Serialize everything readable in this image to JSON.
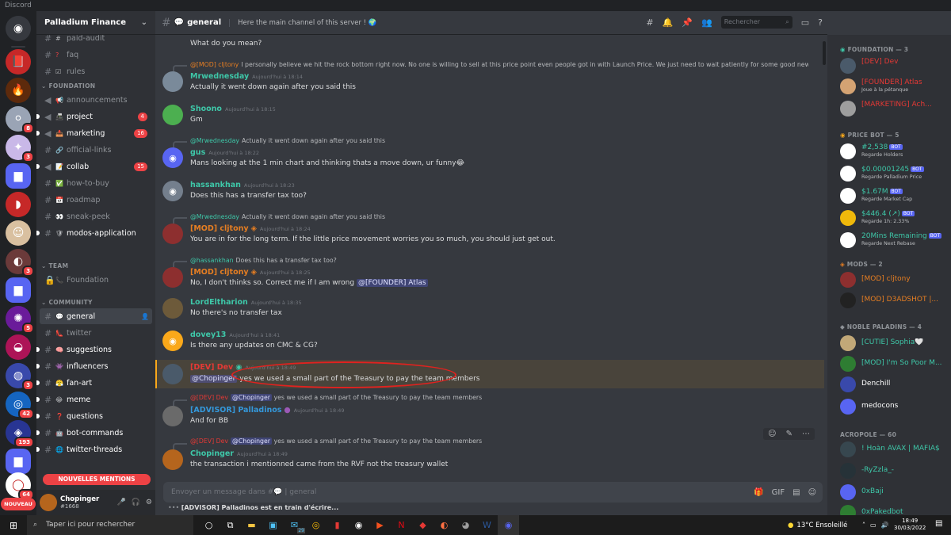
{
  "window_title": "Discord",
  "server": {
    "name": "Palladium Finance"
  },
  "rail": {
    "badges": [
      "8",
      "3",
      "3",
      "5",
      "3",
      "42",
      "193",
      "64"
    ],
    "new_label": "NOUVEAU"
  },
  "channels": {
    "top": [
      {
        "name": "paid-audit",
        "icon": "#"
      },
      {
        "name": "faq",
        "icon": "?"
      },
      {
        "name": "rules",
        "icon": "☑"
      }
    ],
    "cat_foundation": "FOUNDATION",
    "foundation": [
      {
        "name": "announcements",
        "icon": "📢",
        "badge": ""
      },
      {
        "name": "project",
        "icon": "📠",
        "badge": "4"
      },
      {
        "name": "marketing",
        "icon": "📥",
        "badge": "16"
      },
      {
        "name": "official-links",
        "icon": "🔗",
        "badge": ""
      },
      {
        "name": "collab",
        "icon": "📝",
        "badge": "15"
      },
      {
        "name": "how-to-buy",
        "icon": "✅",
        "badge": ""
      },
      {
        "name": "roadmap",
        "icon": "📅",
        "badge": ""
      },
      {
        "name": "sneak-peek",
        "icon": "👀",
        "badge": ""
      },
      {
        "name": "modos-application",
        "icon": "🛡",
        "badge": ""
      }
    ],
    "cat_team": "TEAM",
    "team": [
      {
        "name": "Foundation",
        "icon": "📞"
      }
    ],
    "cat_community": "COMMUNITY",
    "community": [
      {
        "name": "general",
        "icon": "💬"
      },
      {
        "name": "twitter",
        "icon": "👠"
      },
      {
        "name": "suggestions",
        "icon": "🧠"
      },
      {
        "name": "influencers",
        "icon": "👾"
      },
      {
        "name": "fan-art",
        "icon": "😤"
      },
      {
        "name": "meme",
        "icon": "😂"
      },
      {
        "name": "questions",
        "icon": "❓"
      },
      {
        "name": "bot-commands",
        "icon": "🤖"
      },
      {
        "name": "twitter-threads",
        "icon": "🌐"
      }
    ],
    "new_mentions": "NOUVELLES MENTIONS"
  },
  "user": {
    "name": "Chopinger",
    "tag": "#1668"
  },
  "header": {
    "channel": "general",
    "topic": "Here the main channel of this server ! 🌍",
    "search_placeholder": "Rechercher"
  },
  "messages": [
    {
      "author": "",
      "time": "",
      "text": "What do you mean?"
    },
    {
      "reply_author": "@[MOD] cljtony",
      "reply_text": "I personally believe we hit the rock bottom right now. No one is willing to sell at this price point even people got in with Launch Price. We just need to wait patiently for some good news and ...",
      "author": "Mrwednesday",
      "time": "Aujourd'hui à 18:14",
      "text": "Actually it went down again after you said this"
    },
    {
      "author": "Shoono",
      "time": "Aujourd'hui à 18:15",
      "text": "Gm"
    },
    {
      "reply_author": "@Mrwednesday",
      "reply_text": "Actually it went down again after you said this",
      "author": "gus",
      "time": "Aujourd'hui à 18:22",
      "text": "Mans looking at the 1 min chart and thinking thats a move down, ur funny😂"
    },
    {
      "author": "hassankhan",
      "time": "Aujourd'hui à 18:23",
      "text": "Does this has a transfer tax too?"
    },
    {
      "reply_author": "@Mrwednesday",
      "reply_text": "Actually it went down again after you said this",
      "author": "[MOD] cljtony",
      "time": "Aujourd'hui à 18:24",
      "text": "You are in for the long term. If the little price movement worries you so much, you should just get out."
    },
    {
      "reply_author": "@hassankhan",
      "reply_text": "Does this has a transfer tax too?",
      "author": "[MOD] cljtony",
      "time": "Aujourd'hui à 18:25",
      "text": "No, I don't thinks so. Correct me if I am wrong",
      "mention": "@[FOUNDER] Atlas"
    },
    {
      "author": "LordEltharion",
      "time": "Aujourd'hui à 18:35",
      "text": "No there's no transfer tax"
    },
    {
      "author": "dovey13",
      "time": "Aujourd'hui à 18:41",
      "text": "Is there any updates on CMC & CG?"
    },
    {
      "author": "[DEV] Dev",
      "time": "Aujourd'hui à 18:49",
      "mention": "@Chopinger",
      "text": "yes we used a small part of the Treasury to pay the team members"
    },
    {
      "reply_author": "@[DEV] Dev",
      "reply_mention": "@Chopinger",
      "reply_text": "yes we used a small part of the Treasury to pay the team members",
      "author": "[ADVISOR] Palladinos",
      "time": "Aujourd'hui à 18:49",
      "text": "And for BB"
    },
    {
      "reply_author": "@[DEV] Dev",
      "reply_mention": "@Chopinger",
      "reply_text": "yes we used a small part of the Treasury to pay the team members",
      "author": "Chopinger",
      "time": "Aujourd'hui à 18:49",
      "text": "the transaction i mentionned came from the RVF not the treasury wallet"
    }
  ],
  "composer": {
    "placeholder": "Envoyer un message dans #💬 | general"
  },
  "typing": "[ADVISOR] Palladinos est en train d'écrire...",
  "members": {
    "foundation": {
      "title": "FOUNDATION — 3",
      "items": [
        {
          "name": "[DEV] Dev",
          "status": ""
        },
        {
          "name": "[FOUNDER] Atlas",
          "status": "Joue à la pétanque"
        },
        {
          "name": "[MARKETING] Ach...",
          "status": ""
        }
      ]
    },
    "pricebot": {
      "title": "PRICE BOT — 5",
      "items": [
        {
          "name": "#2,538",
          "status": "Regarde Holders"
        },
        {
          "name": "$0.00001245",
          "status": "Regarde Palladium Price"
        },
        {
          "name": "$1.67M",
          "status": "Regarde Market Cap"
        },
        {
          "name": "$446.4 (↗)",
          "status": "Regarde 1h: 2.33%"
        },
        {
          "name": "20Mins Remaining",
          "status": "Regarde Next Rebase"
        }
      ],
      "bot_label": "BOT"
    },
    "mods": {
      "title": "MODS — 2",
      "items": [
        {
          "name": "[MOD] cljtony",
          "status": ""
        },
        {
          "name": "[MOD] D3ADSHOT |...",
          "status": ""
        }
      ]
    },
    "noble": {
      "title": "NOBLE PALADINS — 4",
      "items": [
        {
          "name": "[CUTIE] Sophia🤍",
          "status": ""
        },
        {
          "name": "[MOD] I'm So Poor M...",
          "status": ""
        },
        {
          "name": "Denchill",
          "status": ""
        },
        {
          "name": "medocons",
          "status": ""
        }
      ]
    },
    "acropole": {
      "title": "ACROPOLE — 60",
      "items": [
        {
          "name": "! Hoàn AVAX | MAFIA$",
          "status": ""
        },
        {
          "name": "-RyZzla_-",
          "status": ""
        },
        {
          "name": "0xBaji",
          "status": ""
        },
        {
          "name": "0xPakedbot",
          "status": ""
        }
      ]
    }
  },
  "taskbar": {
    "search": "Taper ici pour rechercher",
    "weather": "13°C  Ensoleillé",
    "time": "18:49",
    "date": "30/03/2022",
    "mail_badge": "29"
  },
  "colors": {
    "accent": "#5865f2",
    "mention_red": "#ed4245",
    "dev_color": "#e53935",
    "mod_color": "#e67e22",
    "advisor_color": "#3498db",
    "highlight": "#faa81a"
  }
}
